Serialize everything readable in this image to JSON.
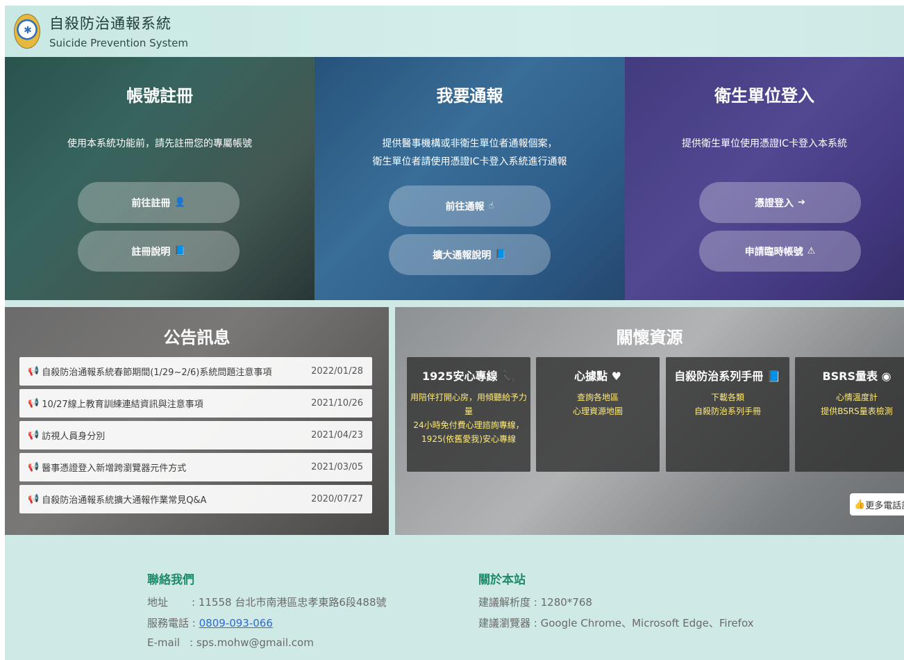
{
  "header": {
    "title": "自殺防治通報系統",
    "subtitle": "Suicide Prevention System"
  },
  "panels": {
    "register": {
      "title": "帳號註冊",
      "desc": "使用本系統功能前，請先註冊您的專屬帳號",
      "btn1": "前往註冊",
      "btn2": "註冊說明"
    },
    "report": {
      "title": "我要通報",
      "desc1": "提供醫事機構或非衛生單位者通報個案，",
      "desc2": "衛生單位者請使用憑證IC卡登入系統進行通報",
      "btn1": "前往通報",
      "btn2": "擴大通報說明"
    },
    "health_login": {
      "title": "衛生單位登入",
      "desc": "提供衛生單位使用憑證IC卡登入本系統",
      "btn1": "憑證登入",
      "btn2": "申請臨時帳號"
    }
  },
  "announcements": {
    "title": "公告訊息",
    "items": [
      {
        "text": "自殺防治通報系統春節期間(1/29~2/6)系統問題注意事項",
        "date": "2022/01/28"
      },
      {
        "text": "10/27線上教育訓練連結資訊與注意事項",
        "date": "2021/10/26"
      },
      {
        "text": "訪視人員身分別",
        "date": "2021/04/23"
      },
      {
        "text": "醫事憑證登入新增跨瀏覽器元件方式",
        "date": "2021/03/05"
      },
      {
        "text": "自殺防治通報系統擴大通報作業常見Q&A",
        "date": "2020/07/27"
      }
    ]
  },
  "care": {
    "title": "關懷資源",
    "cards": [
      {
        "title": "1925安心專線",
        "line1": "用陪伴打開心房，用傾聽給予力量",
        "line2": "24小時免付費心理諮詢專線，",
        "line3": "1925(依舊愛我)安心專線"
      },
      {
        "title": "心據點",
        "line1": "查詢各地區",
        "line2": "心理資源地圖",
        "line3": ""
      },
      {
        "title": "自殺防治系列手冊",
        "line1": "下載各類",
        "line2": "自殺防治系列手冊",
        "line3": ""
      },
      {
        "title": "BSRS量表",
        "line1": "心情溫度計",
        "line2": "提供BSRS量表檢測",
        "line3": ""
      }
    ],
    "more": "更多電話諮詢"
  },
  "footer": {
    "contact_title": "聯絡我們",
    "address_label": "地址",
    "address": "11558 台北市南港區忠孝東路6段488號",
    "phone_label": "服務電話",
    "phone": "0809-093-066",
    "email_label": "E-mail",
    "email": "sps.mohw@gmail.com",
    "about_title": "關於本站",
    "resolution_label": "建議解析度",
    "resolution": "1280*768",
    "browser_label": "建議瀏覽器",
    "browsers": "Google Chrome、Microsoft Edge、Firefox"
  }
}
